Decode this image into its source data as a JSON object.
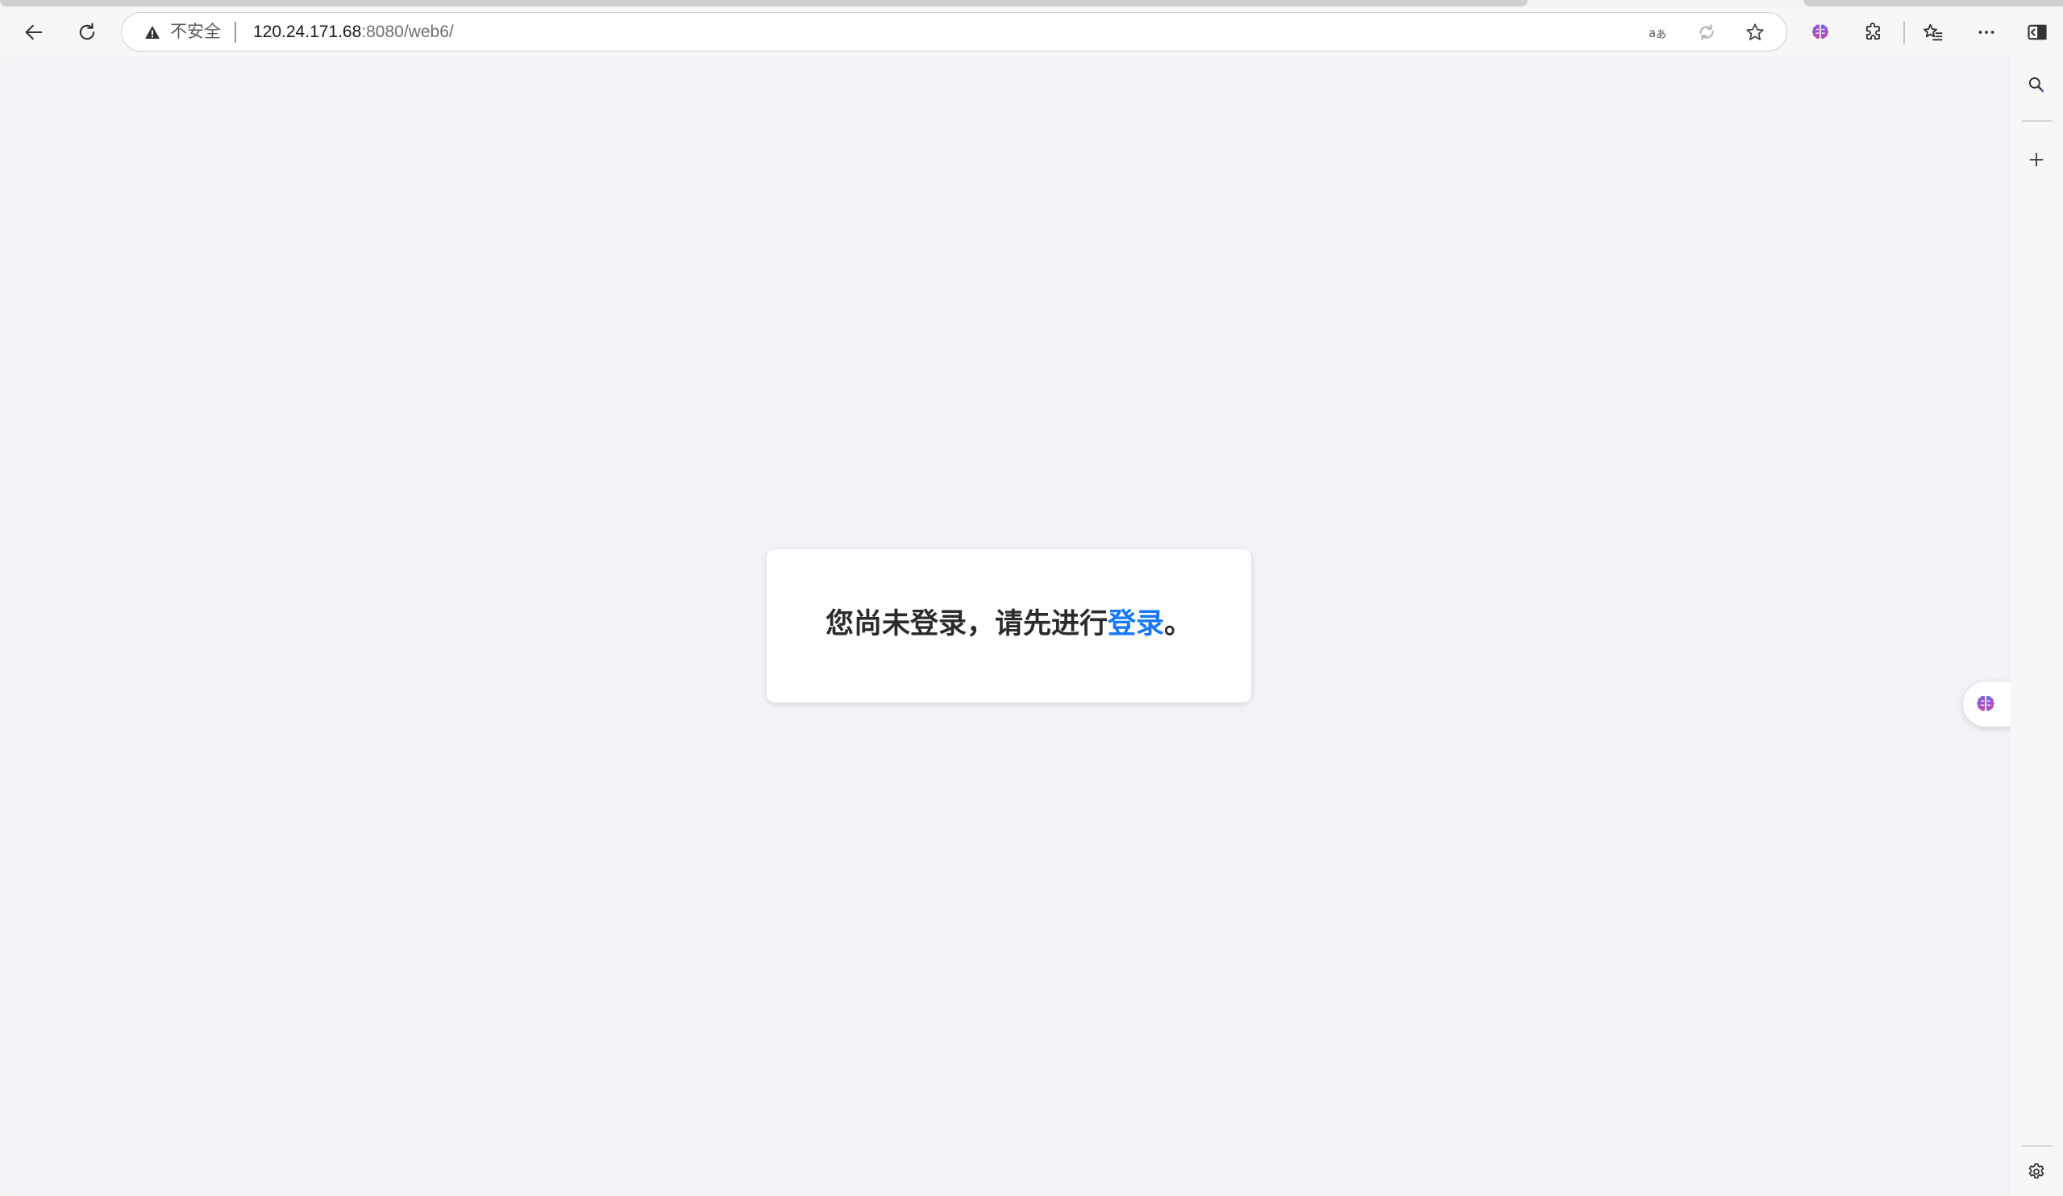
{
  "toolbar": {
    "back_icon": "arrow-left-icon",
    "refresh_icon": "refresh-icon",
    "address": {
      "security_label": "不安全",
      "url_host": "120.24.171.68",
      "url_rest": ":8080/web6/"
    },
    "icons": [
      "translate-icon",
      "reading-mode-icon",
      "favorite-star-icon",
      "brain-extension-icon",
      "extensions-icon",
      "favorites-icon",
      "more-icon",
      "sidebar-toggle-icon"
    ]
  },
  "page": {
    "message_prefix": "您尚未登录，请先进行",
    "login_link": "登录",
    "message_suffix": "。",
    "link_color": "#1677ff"
  },
  "sidebar": {
    "icons": [
      "search-icon",
      "add-icon",
      "settings-icon"
    ]
  }
}
